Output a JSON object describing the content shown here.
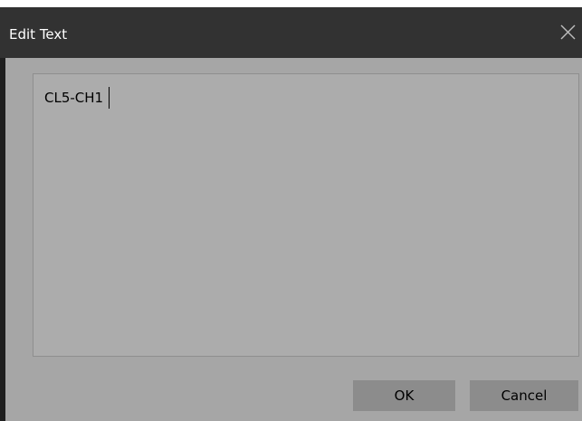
{
  "window": {
    "title": "Edit Text",
    "close_icon": "close-icon"
  },
  "editor": {
    "value": "CL5-CH1"
  },
  "buttons": {
    "ok_label": "OK",
    "cancel_label": "Cancel"
  },
  "colors": {
    "titlebar": "#323232",
    "dialog_body": "#a6a6a6",
    "text_area": "#acacac",
    "button": "#8c8c8c"
  }
}
